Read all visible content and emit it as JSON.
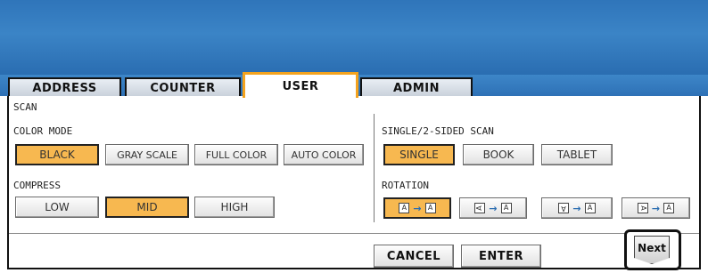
{
  "tabs": [
    {
      "label": "ADDRESS"
    },
    {
      "label": "COUNTER"
    },
    {
      "label": "USER"
    },
    {
      "label": "ADMIN"
    }
  ],
  "active_tab": "USER",
  "section_title": "SCAN",
  "color_mode": {
    "label": "COLOR MODE",
    "options": [
      "BLACK",
      "GRAY SCALE",
      "FULL COLOR",
      "AUTO COLOR"
    ],
    "selected": "BLACK"
  },
  "compress": {
    "label": "COMPRESS",
    "options": [
      "LOW",
      "MID",
      "HIGH"
    ],
    "selected": "MID"
  },
  "sided_scan": {
    "label": "SINGLE/2-SIDED SCAN",
    "options": [
      "SINGLE",
      "BOOK",
      "TABLET"
    ],
    "selected": "SINGLE"
  },
  "rotation": {
    "label": "ROTATION",
    "glyph": "A",
    "arrow": "→",
    "selected_index": 0
  },
  "footer": {
    "cancel_label": "CANCEL",
    "enter_label": "ENTER",
    "next_label": "Next"
  },
  "colors": {
    "banner": "#2f75ba",
    "selected": "#f7b850",
    "active_tab_border": "#f4a31e"
  }
}
